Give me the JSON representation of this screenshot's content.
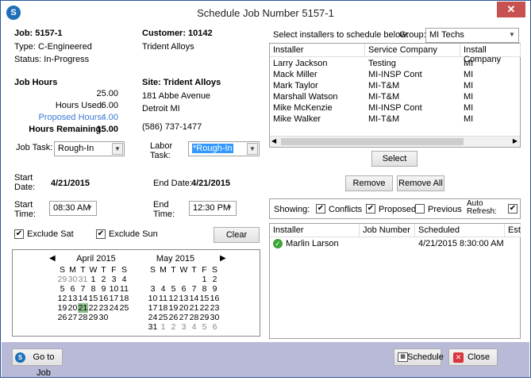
{
  "window": {
    "title": "Schedule Job Number 5157-1",
    "app_icon": "S"
  },
  "job": {
    "job_label": "Job: 5157-1",
    "type": "Type: C-Engineered",
    "status": "Status: In-Progress",
    "customer_label": "Customer: 10142",
    "customer_name": "Trident Alloys"
  },
  "job_hours": {
    "heading": "Job Hours",
    "total": "25.00",
    "used_label": "Hours Used:",
    "used": "6.00",
    "proposed_label": "Proposed Hours:",
    "proposed": "4.00",
    "remaining_label": "Hours Remaining:",
    "remaining": "15.00"
  },
  "site": {
    "heading": "Site: Trident Alloys",
    "addr1": "181 Abbe Avenue",
    "addr2": "Detroit MI",
    "phone": "(586) 737-1477"
  },
  "task": {
    "job_task_label": "Job Task:",
    "job_task_value": "Rough-In",
    "labor_task_label1": "Labor",
    "labor_task_label2": "Task:",
    "labor_task_value": "*Rough-In"
  },
  "dates": {
    "start_label1": "Start",
    "start_label2": "Date:",
    "start_date": "4/21/2015",
    "end_label": "End Date:",
    "end_date": "4/21/2015",
    "start_time_label1": "Start",
    "start_time_label2": "Time:",
    "start_time": "08:30 AM",
    "end_time_label1": "End",
    "end_time_label2": "Time:",
    "end_time": "12:30 PM"
  },
  "exclude": {
    "sat": "Exclude Sat",
    "sun": "Exclude Sun",
    "clear": "Clear"
  },
  "calendar": {
    "april": "April 2015",
    "may": "May 2015",
    "days": [
      "S",
      "M",
      "T",
      "W",
      "T",
      "F",
      "S"
    ],
    "april_rows": [
      [
        "29",
        "30",
        "31",
        "1",
        "2",
        "3",
        "4"
      ],
      [
        "5",
        "6",
        "7",
        "8",
        "9",
        "10",
        "11"
      ],
      [
        "12",
        "13",
        "14",
        "15",
        "16",
        "17",
        "18"
      ],
      [
        "19",
        "20",
        "21",
        "22",
        "23",
        "24",
        "25"
      ],
      [
        "26",
        "27",
        "28",
        "29",
        "30",
        "",
        ""
      ]
    ],
    "may_rows": [
      [
        "",
        "",
        "",
        "",
        "",
        "1",
        "2"
      ],
      [
        "3",
        "4",
        "5",
        "6",
        "7",
        "8",
        "9"
      ],
      [
        "10",
        "11",
        "12",
        "13",
        "14",
        "15",
        "16"
      ],
      [
        "17",
        "18",
        "19",
        "20",
        "21",
        "22",
        "23"
      ],
      [
        "24",
        "25",
        "26",
        "27",
        "28",
        "29",
        "30"
      ],
      [
        "31",
        "1",
        "2",
        "3",
        "4",
        "5",
        "6"
      ]
    ],
    "selected_day": "21"
  },
  "installers": {
    "prompt": "Select installers to schedule below:",
    "group_label": "Group:",
    "group_value": "MI Techs",
    "columns": [
      "Installer",
      "Service Company",
      "Install Company"
    ],
    "rows": [
      [
        "Larry Jackson",
        "Testing",
        "MI"
      ],
      [
        "Mack Miller",
        "MI-INSP Cont",
        "MI"
      ],
      [
        "Mark Taylor",
        "MI-T&M",
        "MI"
      ],
      [
        "Marshall Watson",
        "MI-T&M",
        "MI"
      ],
      [
        "Mike McKenzie",
        "MI-INSP Cont",
        "MI"
      ],
      [
        "Mike Walker",
        "MI-T&M",
        "MI"
      ]
    ],
    "select_btn": "Select",
    "remove_btn": "Remove",
    "remove_all_btn": "Remove All"
  },
  "showing": {
    "label": "Showing:",
    "conflicts": "Conflicts",
    "proposed": "Proposed",
    "previous": "Previous",
    "auto_refresh1": "Auto",
    "auto_refresh2": "Refresh:"
  },
  "scheduled": {
    "columns": [
      "Installer",
      "Job Number",
      "Scheduled",
      "Est"
    ],
    "rows": [
      [
        "Marlin Larson",
        "",
        "4/21/2015 8:30:00 AM",
        ""
      ]
    ]
  },
  "footer": {
    "go_to_job": "Go to Job",
    "schedule": "Schedule",
    "close": "Close"
  }
}
